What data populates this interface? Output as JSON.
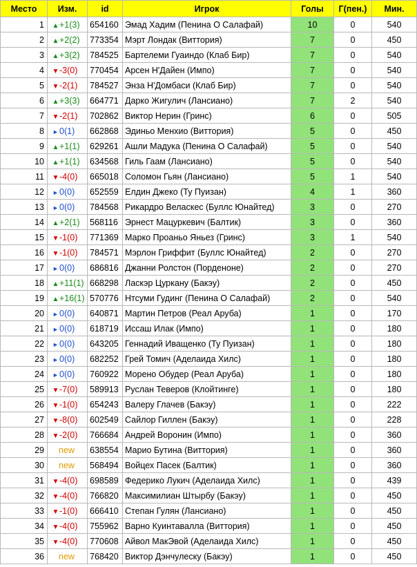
{
  "headers": {
    "place": "Место",
    "change": "Изм.",
    "id": "id",
    "player": "Игрок",
    "goals": "Голы",
    "penalties": "Г(пен.)",
    "minutes": "Мин."
  },
  "colors": {
    "header_bg": "#ffff00",
    "goals_bg": "#92e27a",
    "up": "#1a8a1a",
    "down": "#d00000",
    "same": "#1f4fd0",
    "new": "#e09a00"
  },
  "icons": {
    "up": "triangle-up-icon",
    "down": "triangle-down-icon",
    "same": "triangle-right-icon"
  },
  "rows": [
    {
      "place": "1",
      "dir": "up",
      "change": "+1(3)",
      "id": "654160",
      "player": "Эмад Хадим (Пенина О Салафай)",
      "goals": "10",
      "pen": "0",
      "min": "540"
    },
    {
      "place": "2",
      "dir": "up",
      "change": "+2(2)",
      "id": "773354",
      "player": "Мэрт Лондак (Виттория)",
      "goals": "7",
      "pen": "0",
      "min": "450"
    },
    {
      "place": "3",
      "dir": "up",
      "change": "+3(2)",
      "id": "784525",
      "player": "Бартелеми Гуаиндо (Клаб Бир)",
      "goals": "7",
      "pen": "0",
      "min": "540"
    },
    {
      "place": "4",
      "dir": "down",
      "change": "-3(0)",
      "id": "770454",
      "player": "Арсен Н'Дайен (Импо)",
      "goals": "7",
      "pen": "0",
      "min": "540"
    },
    {
      "place": "5",
      "dir": "down",
      "change": "-2(1)",
      "id": "784527",
      "player": "Энза Н'Домбаси (Клаб Бир)",
      "goals": "7",
      "pen": "0",
      "min": "540"
    },
    {
      "place": "6",
      "dir": "up",
      "change": "+3(3)",
      "id": "664771",
      "player": "Дарко Жигулич (Лансиано)",
      "goals": "7",
      "pen": "2",
      "min": "540"
    },
    {
      "place": "7",
      "dir": "down",
      "change": "-2(1)",
      "id": "702862",
      "player": "Виктор Нерин (Гринс)",
      "goals": "6",
      "pen": "0",
      "min": "505"
    },
    {
      "place": "8",
      "dir": "same",
      "change": "0(1)",
      "id": "662868",
      "player": "Эдиньо Менхио (Виттория)",
      "goals": "5",
      "pen": "0",
      "min": "450"
    },
    {
      "place": "9",
      "dir": "up",
      "change": "+1(1)",
      "id": "629261",
      "player": "Ашли Мадука (Пенина О Салафай)",
      "goals": "5",
      "pen": "0",
      "min": "540"
    },
    {
      "place": "10",
      "dir": "up",
      "change": "+1(1)",
      "id": "634568",
      "player": "Гиль Гаам (Лансиано)",
      "goals": "5",
      "pen": "0",
      "min": "540"
    },
    {
      "place": "11",
      "dir": "down",
      "change": "-4(0)",
      "id": "665018",
      "player": "Соломон Гьян (Лансиано)",
      "goals": "5",
      "pen": "1",
      "min": "540"
    },
    {
      "place": "12",
      "dir": "same",
      "change": "0(0)",
      "id": "652559",
      "player": "Елдин Джеко (Ту Пуизан)",
      "goals": "4",
      "pen": "1",
      "min": "360"
    },
    {
      "place": "13",
      "dir": "same",
      "change": "0(0)",
      "id": "784568",
      "player": "Рикардро Веласкес (Буллс Юнайтед)",
      "goals": "3",
      "pen": "0",
      "min": "270"
    },
    {
      "place": "14",
      "dir": "up",
      "change": "+2(1)",
      "id": "568116",
      "player": "Эрнест Мацуркевич (Балтик)",
      "goals": "3",
      "pen": "0",
      "min": "360"
    },
    {
      "place": "15",
      "dir": "down",
      "change": "-1(0)",
      "id": "771369",
      "player": "Марко Проаньо Яньез (Гринс)",
      "goals": "3",
      "pen": "1",
      "min": "540"
    },
    {
      "place": "16",
      "dir": "down",
      "change": "-1(0)",
      "id": "784571",
      "player": "Мэрлон Гриффит (Буллс Юнайтед)",
      "goals": "2",
      "pen": "0",
      "min": "270"
    },
    {
      "place": "17",
      "dir": "same",
      "change": "0(0)",
      "id": "686816",
      "player": "Джанни Ролстон (Порденоне)",
      "goals": "2",
      "pen": "0",
      "min": "270"
    },
    {
      "place": "18",
      "dir": "up",
      "change": "+11(1)",
      "id": "668298",
      "player": "Ласкэр Цуркану (Бакэу)",
      "goals": "2",
      "pen": "0",
      "min": "450"
    },
    {
      "place": "19",
      "dir": "up",
      "change": "+16(1)",
      "id": "570776",
      "player": "Нтсуми Гудинг (Пенина О Салафай)",
      "goals": "2",
      "pen": "0",
      "min": "540"
    },
    {
      "place": "20",
      "dir": "same",
      "change": "0(0)",
      "id": "640871",
      "player": "Мартин Петров (Реал Аруба)",
      "goals": "1",
      "pen": "0",
      "min": "170"
    },
    {
      "place": "21",
      "dir": "same",
      "change": "0(0)",
      "id": "618719",
      "player": "Иссаш Илак (Импо)",
      "goals": "1",
      "pen": "0",
      "min": "180"
    },
    {
      "place": "22",
      "dir": "same",
      "change": "0(0)",
      "id": "643205",
      "player": "Геннадий Иващенко (Ту Пуизан)",
      "goals": "1",
      "pen": "0",
      "min": "180"
    },
    {
      "place": "23",
      "dir": "same",
      "change": "0(0)",
      "id": "682252",
      "player": "Грей Томич (Аделаида Хилс)",
      "goals": "1",
      "pen": "0",
      "min": "180"
    },
    {
      "place": "24",
      "dir": "same",
      "change": "0(0)",
      "id": "760922",
      "player": "Морено Обудер (Реал Аруба)",
      "goals": "1",
      "pen": "0",
      "min": "180"
    },
    {
      "place": "25",
      "dir": "down",
      "change": "-7(0)",
      "id": "589913",
      "player": "Руслан Теверов (Клойтинге)",
      "goals": "1",
      "pen": "0",
      "min": "180"
    },
    {
      "place": "26",
      "dir": "down",
      "change": "-1(0)",
      "id": "654243",
      "player": "Валеру Глачев (Бакэу)",
      "goals": "1",
      "pen": "0",
      "min": "222"
    },
    {
      "place": "27",
      "dir": "down",
      "change": "-8(0)",
      "id": "602549",
      "player": "Сайлор Гиллен (Бакэу)",
      "goals": "1",
      "pen": "0",
      "min": "228"
    },
    {
      "place": "28",
      "dir": "down",
      "change": "-2(0)",
      "id": "766684",
      "player": "Андрей Воронин (Импо)",
      "goals": "1",
      "pen": "0",
      "min": "360"
    },
    {
      "place": "29",
      "dir": "new",
      "change": "new",
      "id": "638554",
      "player": "Марио Бутина (Виттория)",
      "goals": "1",
      "pen": "0",
      "min": "360"
    },
    {
      "place": "30",
      "dir": "new",
      "change": "new",
      "id": "568494",
      "player": "Войцех Пасек (Балтик)",
      "goals": "1",
      "pen": "0",
      "min": "360"
    },
    {
      "place": "31",
      "dir": "down",
      "change": "-4(0)",
      "id": "698589",
      "player": "Федерико Лукич (Аделаида Хилс)",
      "goals": "1",
      "pen": "0",
      "min": "439"
    },
    {
      "place": "32",
      "dir": "down",
      "change": "-4(0)",
      "id": "766820",
      "player": "Максимилиан Штырбу (Бакэу)",
      "goals": "1",
      "pen": "0",
      "min": "450"
    },
    {
      "place": "33",
      "dir": "down",
      "change": "-1(0)",
      "id": "666410",
      "player": "Степан Гулян (Лансиано)",
      "goals": "1",
      "pen": "0",
      "min": "450"
    },
    {
      "place": "34",
      "dir": "down",
      "change": "-4(0)",
      "id": "755962",
      "player": "Варно Куинтавалла (Виттория)",
      "goals": "1",
      "pen": "0",
      "min": "450"
    },
    {
      "place": "35",
      "dir": "down",
      "change": "-4(0)",
      "id": "770608",
      "player": "Айвол МакЭвой (Аделаида Хилс)",
      "goals": "1",
      "pen": "0",
      "min": "450"
    },
    {
      "place": "36",
      "dir": "new",
      "change": "new",
      "id": "768420",
      "player": "Виктор Дэнчулеску (Бакэу)",
      "goals": "1",
      "pen": "0",
      "min": "450"
    }
  ]
}
